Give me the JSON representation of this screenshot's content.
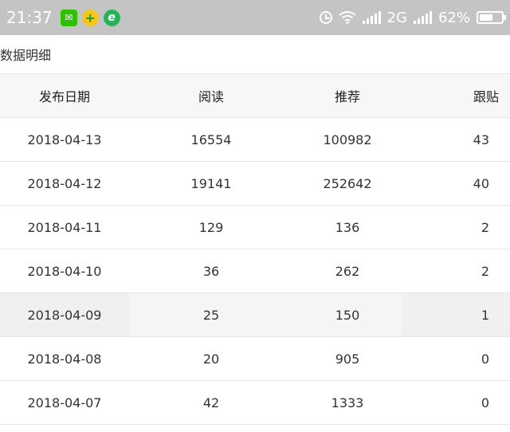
{
  "status_bar": {
    "time": "21:37",
    "network": "2G",
    "battery_percent": "62%",
    "battery_level": 0.62,
    "icons": [
      "wechat-icon",
      "plus-app-icon",
      "browser-e-icon",
      "alarm-icon",
      "wifi-icon",
      "signal-icon",
      "battery-icon"
    ]
  },
  "page": {
    "title": "数据明细"
  },
  "table": {
    "headers": [
      "发布日期",
      "阅读",
      "推荐",
      "跟贴"
    ],
    "rows": [
      [
        "2018-04-13",
        "16554",
        "100982",
        "43"
      ],
      [
        "2018-04-12",
        "19141",
        "252642",
        "40"
      ],
      [
        "2018-04-11",
        "129",
        "136",
        "2"
      ],
      [
        "2018-04-10",
        "36",
        "262",
        "2"
      ],
      [
        "2018-04-09",
        "25",
        "150",
        "1"
      ],
      [
        "2018-04-08",
        "20",
        "905",
        "0"
      ],
      [
        "2018-04-07",
        "42",
        "1333",
        "0"
      ]
    ]
  }
}
